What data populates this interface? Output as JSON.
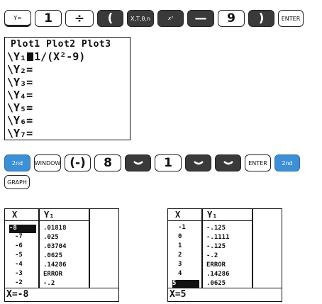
{
  "row1": {
    "yeq": "Y=",
    "one": "1",
    "divide": "÷",
    "lparen": "(",
    "xton": "X,T,θ,n",
    "squared": "x²",
    "minus": "—",
    "nine": "9",
    "rparen": ")",
    "enter": "ENTER"
  },
  "yscreen": {
    "plots": "Plot1 Plot2 Plot3",
    "lines": [
      "\\Y₁",
      "1/(X²-9)",
      "\\Y₂=",
      "\\Y₃=",
      "\\Y₄=",
      "\\Y₅=",
      "\\Y₆=",
      "\\Y₇="
    ]
  },
  "row2": {
    "second": "2nd",
    "window": "WINDOW",
    "neg": "(-)",
    "eight": "8",
    "one": "1",
    "enter": "ENTER",
    "second2": "2nd",
    "graph": "GRAPH"
  },
  "table_left": {
    "hx": "X",
    "hy": "Y₁",
    "x": [
      "-8",
      "-7",
      "-6",
      "-5",
      "-4",
      "-3",
      "-2"
    ],
    "y": [
      ".01818",
      ".025",
      ".03704",
      ".0625",
      ".14286",
      "ERROR",
      "-.2"
    ],
    "footer": "X=-8"
  },
  "table_right": {
    "hx": "X",
    "hy": "Y₁",
    "x": [
      "-1",
      "0",
      "1",
      "2",
      "3",
      "4",
      "5"
    ],
    "y": [
      "-.125",
      "-.1111",
      "-.125",
      "-.2",
      "ERROR",
      ".14286",
      ".0625"
    ],
    "footer": "X=5"
  },
  "colors": {
    "blue_key": "#3d8fd6",
    "dark_key": "#3a3a3a"
  }
}
